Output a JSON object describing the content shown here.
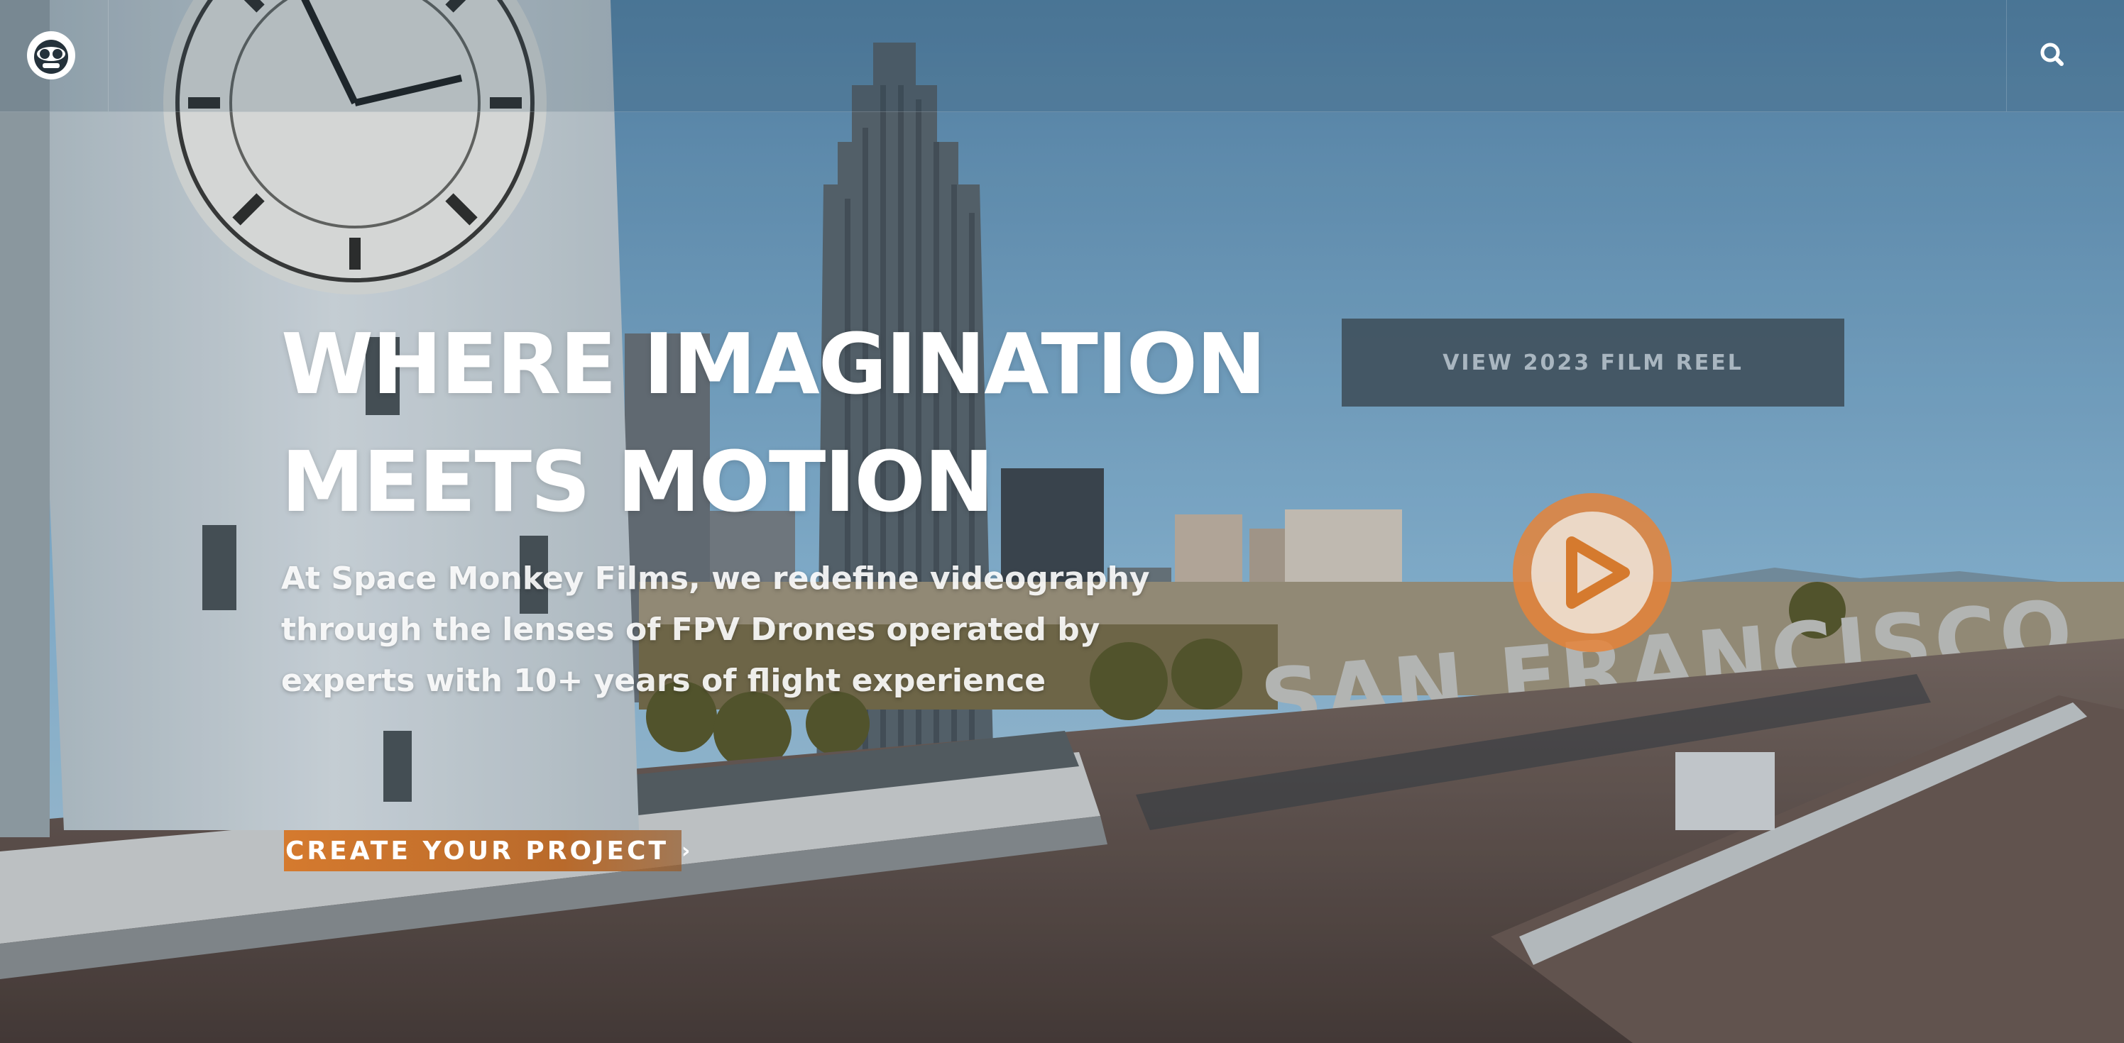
{
  "colors": {
    "accent": "#d57a2e",
    "headline": "#ffffff",
    "reel_button_bg": "#41525f",
    "reel_button_text": "#a9b6c0"
  },
  "nav": {
    "logo_icon": "monkey-logo-icon",
    "search_icon": "search-icon"
  },
  "hero": {
    "headline_line1": "WHERE IMAGINATION",
    "headline_line2": "MEETS MOTION",
    "lede": "At Space Monkey Films, we redefine videography through the lenses of FPV Drones operated by experts with 10+ years of flight experience",
    "cta_label": "CREATE YOUR PROJECT",
    "cta_icon": "chevron-right-icon",
    "reel_button_label": "VIEW 2023 FILM REEL",
    "play_icon": "play-icon"
  },
  "background": {
    "sign_text": "SAN FRANCISCO"
  }
}
